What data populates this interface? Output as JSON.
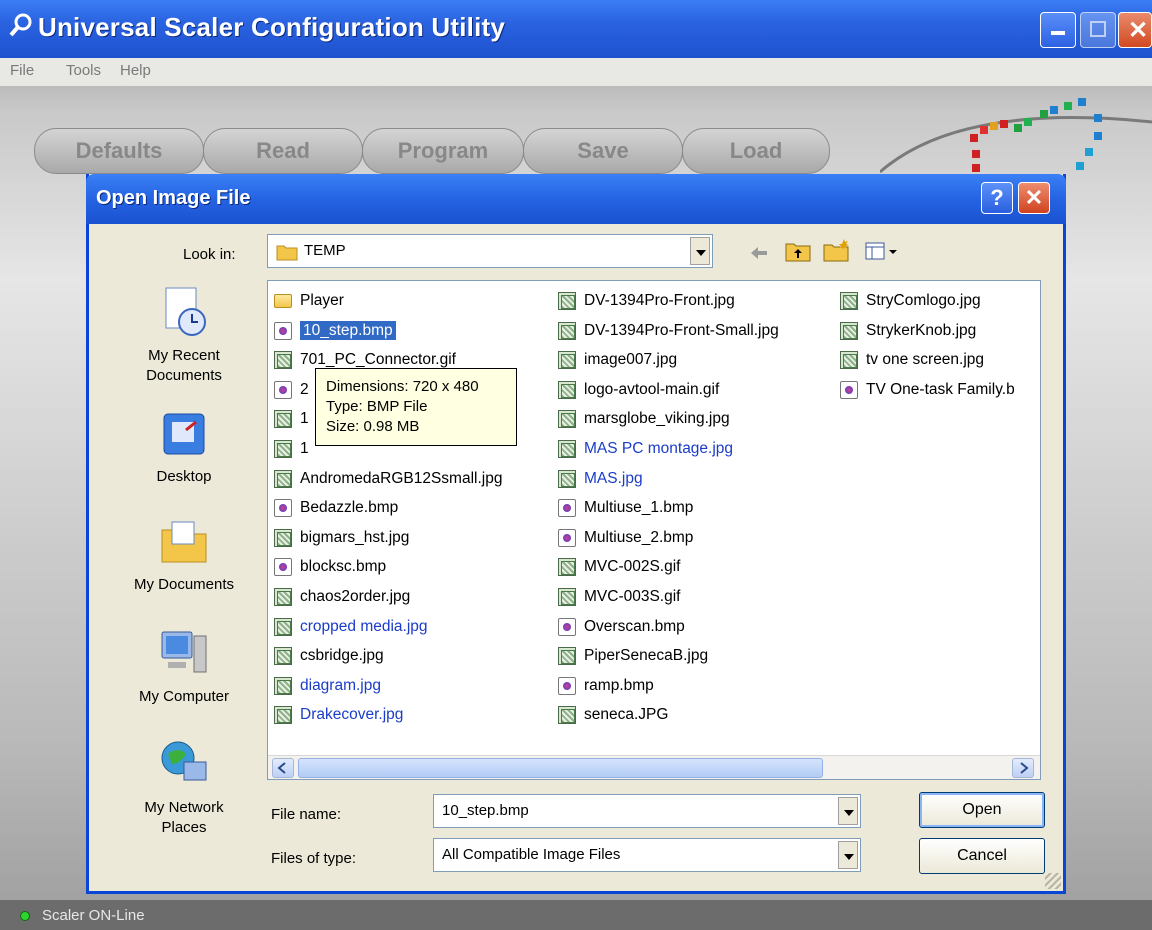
{
  "app": {
    "title": "Universal Scaler Configuration Utility",
    "menu": [
      "File",
      "Tools",
      "Help"
    ],
    "toolbar": [
      "Defaults",
      "Read",
      "Program",
      "Save",
      "Load"
    ],
    "status": "Scaler ON-Line",
    "colors": {
      "title_blue": "#2a62e0",
      "led_green": "#2ed42e"
    }
  },
  "dialog": {
    "title": "Open Image File",
    "help_button": "?",
    "look_in_label": "Look in:",
    "look_in_value": "TEMP",
    "places": [
      "My Recent Documents",
      "Desktop",
      "My Documents",
      "My Computer",
      "My Network Places"
    ],
    "files": {
      "col1": [
        {
          "name": "Player",
          "type": "folder"
        },
        {
          "name": "10_step.bmp",
          "type": "bmp",
          "selected": true
        },
        {
          "name": "701_PC_Connector.gif",
          "type": "jpg"
        },
        {
          "name": "2",
          "type": "bmp"
        },
        {
          "name": "1",
          "type": "jpg"
        },
        {
          "name": "1",
          "type": "jpg"
        },
        {
          "name": "AndromedaRGB12Ssmall.jpg",
          "type": "jpg"
        },
        {
          "name": "Bedazzle.bmp",
          "type": "bmp"
        },
        {
          "name": "bigmars_hst.jpg",
          "type": "jpg"
        },
        {
          "name": "blocksc.bmp",
          "type": "bmp"
        },
        {
          "name": "chaos2order.jpg",
          "type": "jpg"
        },
        {
          "name": "cropped media.jpg",
          "type": "jpg",
          "blue": true
        },
        {
          "name": "csbridge.jpg",
          "type": "jpg"
        },
        {
          "name": "diagram.jpg",
          "type": "jpg",
          "blue": true
        },
        {
          "name": "Drakecover.jpg",
          "type": "jpg",
          "blue": true
        }
      ],
      "col2": [
        {
          "name": "DV-1394Pro-Front.jpg",
          "type": "jpg"
        },
        {
          "name": "DV-1394Pro-Front-Small.jpg",
          "type": "jpg"
        },
        {
          "name": "image007.jpg",
          "type": "jpg"
        },
        {
          "name": "logo-avtool-main.gif",
          "type": "jpg"
        },
        {
          "name": "marsglobe_viking.jpg",
          "type": "jpg"
        },
        {
          "name": "MAS PC montage.jpg",
          "type": "jpg",
          "blue": true
        },
        {
          "name": "MAS.jpg",
          "type": "jpg",
          "blue": true
        },
        {
          "name": "Multiuse_1.bmp",
          "type": "bmp"
        },
        {
          "name": "Multiuse_2.bmp",
          "type": "bmp"
        },
        {
          "name": "MVC-002S.gif",
          "type": "jpg"
        },
        {
          "name": "MVC-003S.gif",
          "type": "jpg"
        },
        {
          "name": "Overscan.bmp",
          "type": "bmp"
        },
        {
          "name": "PiperSenecaB.jpg",
          "type": "jpg"
        },
        {
          "name": "ramp.bmp",
          "type": "bmp"
        },
        {
          "name": "seneca.JPG",
          "type": "jpg"
        }
      ],
      "col3": [
        {
          "name": "StryComlogo.jpg",
          "type": "jpg"
        },
        {
          "name": "StrykerKnob.jpg",
          "type": "jpg"
        },
        {
          "name": "tv one screen.jpg",
          "type": "jpg"
        },
        {
          "name": "TV One-task Family.b",
          "type": "bmp"
        }
      ]
    },
    "tooltip": [
      "Dimensions: 720 x 480",
      "Type: BMP File",
      "Size: 0.98 MB"
    ],
    "file_name_label": "File name:",
    "file_name_value": "10_step.bmp",
    "file_type_label": "Files of type:",
    "file_type_value": "All Compatible Image Files",
    "open_label": "Open",
    "cancel_label": "Cancel"
  }
}
